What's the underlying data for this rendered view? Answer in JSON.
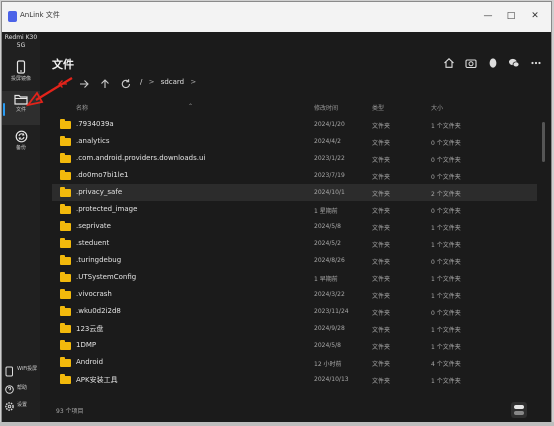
{
  "window": {
    "title": "AnLink 文件"
  },
  "device": {
    "name_line1": "Redmi K30",
    "name_line2": "5G"
  },
  "sidebar": {
    "items": [
      {
        "label": "投屏镜像",
        "icon": "phone-icon"
      },
      {
        "label": "文件",
        "icon": "folder-icon"
      },
      {
        "label": "备份",
        "icon": "sync-icon"
      }
    ],
    "bottom": [
      {
        "label": "WiFi投屏",
        "icon": "wifi-phone-icon"
      },
      {
        "label": "帮助",
        "icon": "help-icon"
      },
      {
        "label": "设置",
        "icon": "gear-icon"
      }
    ]
  },
  "header": {
    "title": "文件"
  },
  "navigation": {
    "root": "/",
    "separator": ">",
    "path": "sdcard"
  },
  "columns": {
    "name": "名称",
    "date": "修改时间",
    "type": "类型",
    "size": "大小"
  },
  "files": [
    {
      "name": ".7934039a",
      "date": "2024/1/20",
      "type": "文件夹",
      "size": "1 个文件夹"
    },
    {
      "name": ".analytics",
      "date": "2024/4/2",
      "type": "文件夹",
      "size": "0 个文件夹"
    },
    {
      "name": ".com.android.providers.downloads.ui",
      "date": "2023/1/22",
      "type": "文件夹",
      "size": "0 个文件夹"
    },
    {
      "name": ".do0mo7bi1le1",
      "date": "2023/7/19",
      "type": "文件夹",
      "size": "0 个文件夹"
    },
    {
      "name": ".privacy_safe",
      "date": "2024/10/1",
      "type": "文件夹",
      "size": "2 个文件夹"
    },
    {
      "name": ".protected_image",
      "date": "1 星期前",
      "type": "文件夹",
      "size": "0 个文件夹"
    },
    {
      "name": ".seprivate",
      "date": "2024/5/8",
      "type": "文件夹",
      "size": "1 个文件夹"
    },
    {
      "name": ".steduent",
      "date": "2024/5/2",
      "type": "文件夹",
      "size": "1 个文件夹"
    },
    {
      "name": ".turingdebug",
      "date": "2024/8/26",
      "type": "文件夹",
      "size": "0 个文件夹"
    },
    {
      "name": ".UTSystemConfig",
      "date": "1 早期前",
      "type": "文件夹",
      "size": "1 个文件夹"
    },
    {
      "name": ".vivocrash",
      "date": "2024/3/22",
      "type": "文件夹",
      "size": "1 个文件夹"
    },
    {
      "name": ".wku0d2i2d8",
      "date": "2023/11/24",
      "type": "文件夹",
      "size": "0 个文件夹"
    },
    {
      "name": "123云盘",
      "date": "2024/9/28",
      "type": "文件夹",
      "size": "1 个文件夹"
    },
    {
      "name": "1DMP",
      "date": "2024/5/8",
      "type": "文件夹",
      "size": "1 个文件夹"
    },
    {
      "name": "Android",
      "date": "12 小时前",
      "type": "文件夹",
      "size": "4 个文件夹"
    },
    {
      "name": "APK安装工具",
      "date": "2024/10/13",
      "type": "文件夹",
      "size": "1 个文件夹"
    }
  ],
  "selected_index": 4,
  "status": {
    "item_count": "93 个项目"
  },
  "colors": {
    "accent": "#2a9df4",
    "folder": "#f2b90c",
    "annotation": "#e2231a",
    "background": "#1b1b1b"
  }
}
